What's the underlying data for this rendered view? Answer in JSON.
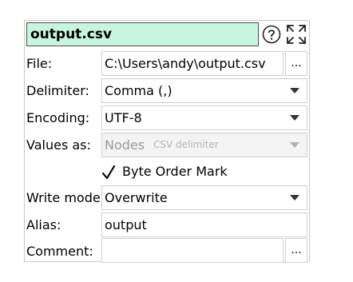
{
  "header": {
    "title": "output.csv",
    "help_icon": "question-circle-icon",
    "expand_icon": "expand-arrows-icon"
  },
  "fields": {
    "file": {
      "label": "File:",
      "value": "C:\\Users\\andy\\output.csv",
      "browse_label": "..."
    },
    "delimiter": {
      "label": "Delimiter:",
      "value": "Comma (,)"
    },
    "encoding": {
      "label": "Encoding:",
      "value": "UTF-8"
    },
    "values_as": {
      "label": "Values as:",
      "value": "Nodes",
      "hint": "CSV delimiter",
      "disabled": true
    },
    "byte_order_mark": {
      "label": "Byte Order Mark",
      "checked": true
    },
    "write_mode": {
      "label": "Write mode:",
      "value": "Overwrite"
    },
    "alias": {
      "label": "Alias:",
      "value": "output"
    },
    "comment": {
      "label": "Comment:",
      "value": "",
      "browse_label": "..."
    }
  },
  "colors": {
    "title_bg": "#c9f4df",
    "border": "#cfcfcf",
    "disabled_text": "#9a9a9a"
  }
}
